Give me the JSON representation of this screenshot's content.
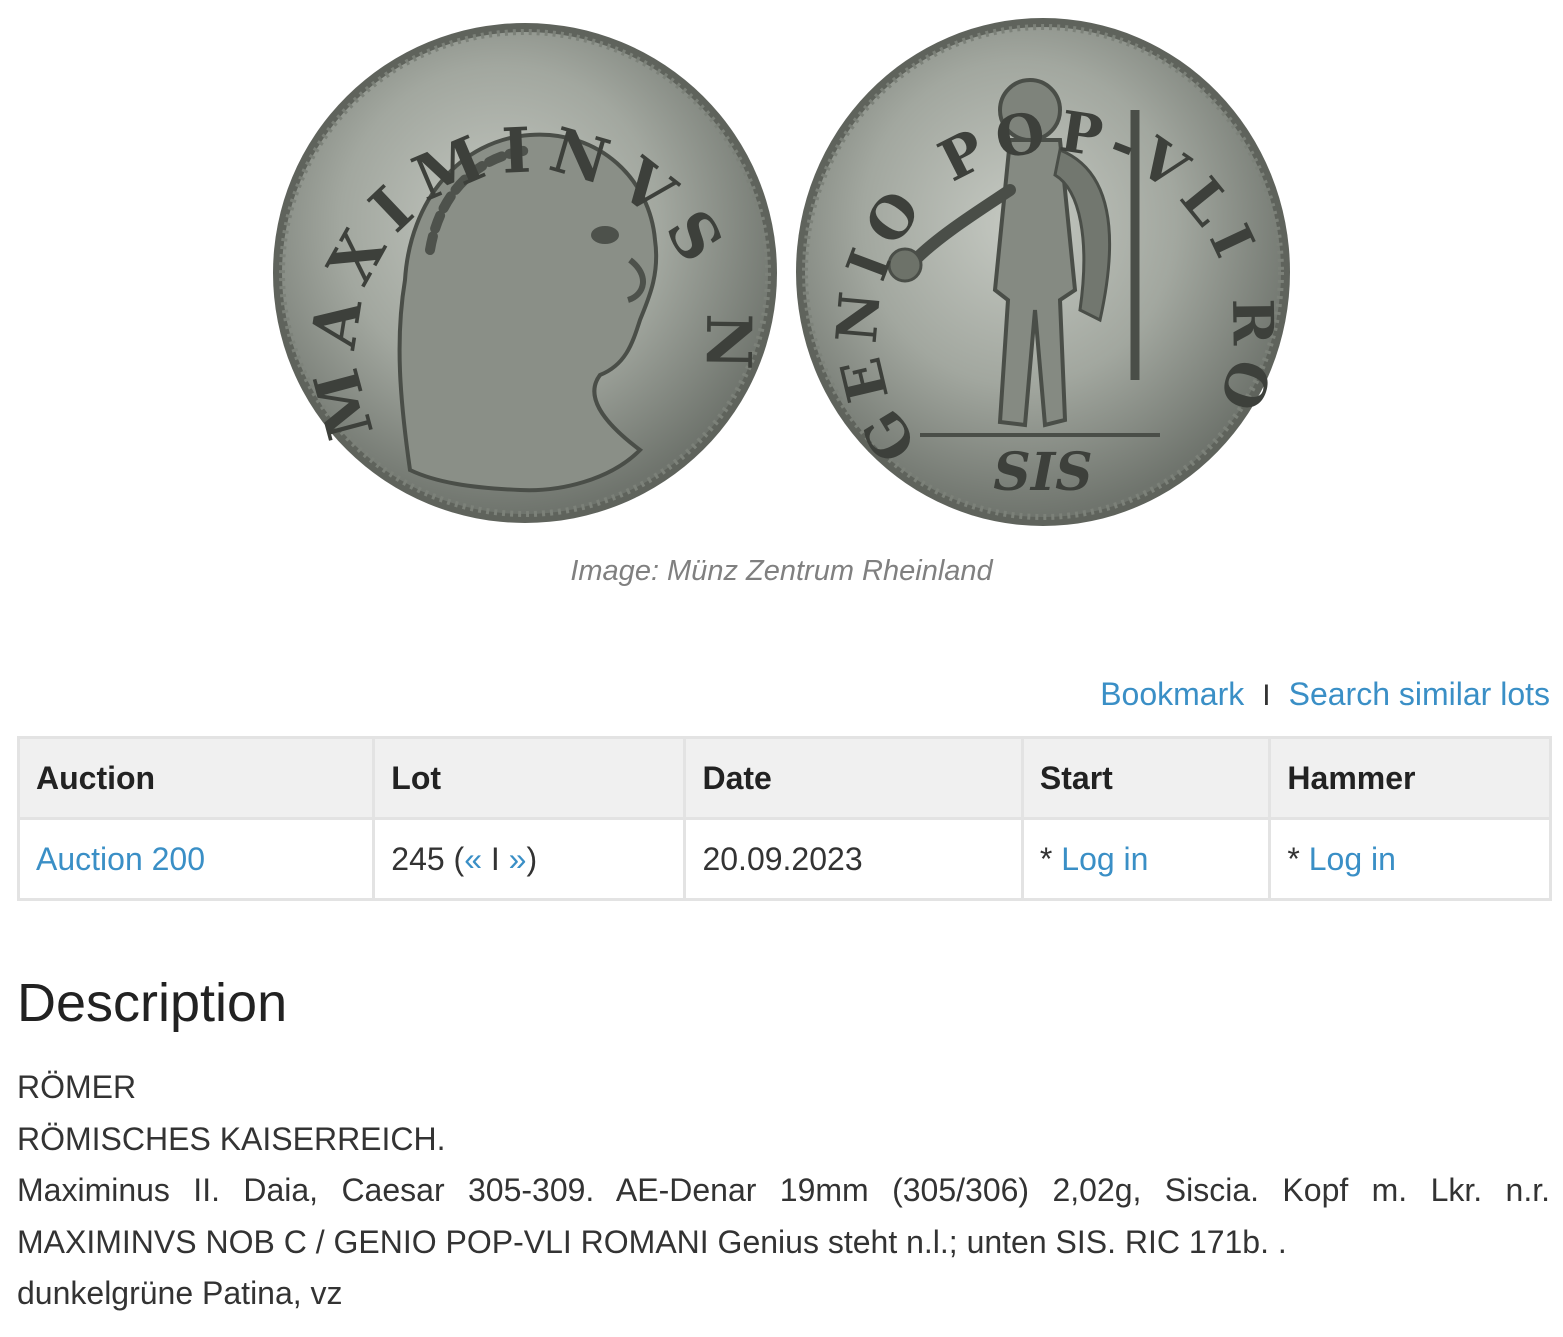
{
  "images": {
    "obverse_legend": "MAXIMINVS NOB C",
    "reverse_legend": "GENIO POP-VLI ROMANI",
    "mintmark": "SIS",
    "caption": "Image: Münz Zentrum Rheinland"
  },
  "actions": {
    "bookmark": "Bookmark",
    "separator": "I",
    "search_similar": "Search similar lots"
  },
  "table": {
    "headers": {
      "auction": "Auction",
      "lot": "Lot",
      "date": "Date",
      "start": "Start",
      "hammer": "Hammer"
    },
    "row": {
      "auction": "Auction 200",
      "lot_number": "245 (",
      "lot_prev": "«",
      "lot_sep": " I ",
      "lot_next": "»",
      "lot_close": ")",
      "date": "20.09.2023",
      "start_prefix": "* ",
      "start_link": "Log in",
      "hammer_prefix": "* ",
      "hammer_link": "Log in"
    }
  },
  "description": {
    "heading": "Description",
    "line1": "RÖMER",
    "line2": "RÖMISCHES KAISERREICH.",
    "line3": "Maximinus II. Daia, Caesar 305-309. AE-Denar 19mm (305/306) 2,02g, Siscia. Kopf m. Lkr. n.r.",
    "line4": "MAXIMINVS NOB C / GENIO POP-VLI ROMANI Genius steht n.l.; unten SIS. RIC 171b. .",
    "line5": "dunkelgrüne Patina, vz"
  },
  "colors": {
    "link": "#3a8fc6",
    "header_bg": "#f0f0f0",
    "border": "#e3e3e3",
    "coin_metal": "#9aa096"
  }
}
